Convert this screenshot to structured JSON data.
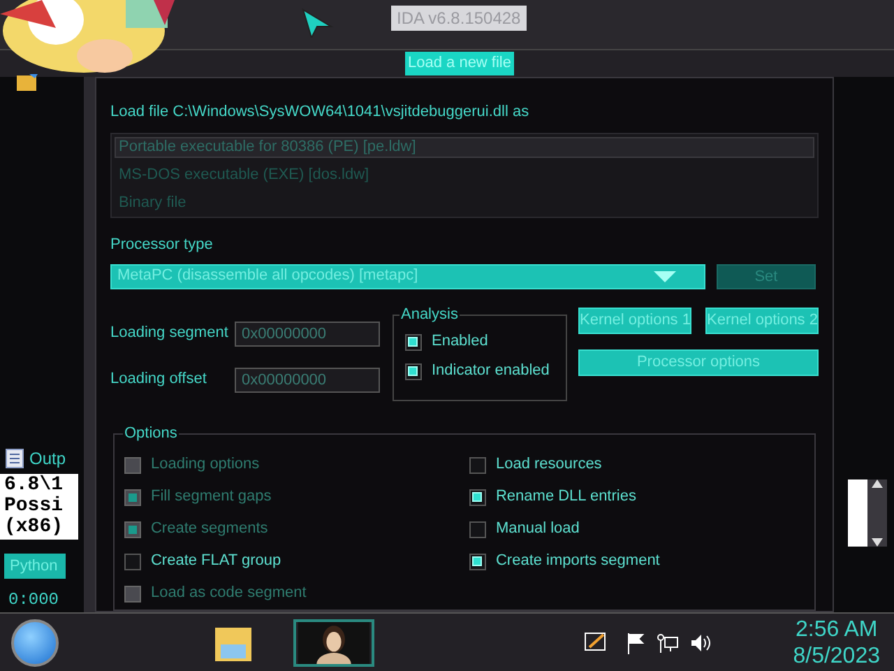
{
  "app_title": "IDA v6.8.150428",
  "left_panel": {
    "output_tab": "Outp",
    "console_lines": [
      "6.8\\1",
      "Possi",
      "(x86)"
    ],
    "python_button": "Python",
    "status": "0:000"
  },
  "dialog": {
    "title": "Load a new file",
    "file_label": "Load file C:\\Windows\\SysWOW64\\1041\\vsjitdebuggerui.dll as",
    "formats": [
      {
        "label": "Portable executable for 80386 (PE) [pe.ldw]",
        "selected": true
      },
      {
        "label": "MS-DOS executable (EXE) [dos.ldw]",
        "selected": false
      },
      {
        "label": "Binary file",
        "selected": false
      }
    ],
    "processor_label": "Processor type",
    "processor": "MetaPC (disassemble all opcodes) [metapc]",
    "set_button": {
      "label": "Set",
      "disabled": true
    },
    "loading_segment": {
      "label": "Loading segment",
      "value": "0x00000000"
    },
    "loading_offset": {
      "label": "Loading offset",
      "value": "0x00000000"
    },
    "analysis": {
      "title": "Analysis",
      "options": [
        {
          "label": "Enabled",
          "checked": true
        },
        {
          "label": "Indicator enabled",
          "checked": true
        }
      ]
    },
    "kernel_buttons": [
      "Kernel options 1",
      "Kernel options 2"
    ],
    "processor_options_button": "Processor options",
    "options": {
      "title": "Options",
      "items": [
        {
          "label": "Loading options",
          "checked": false,
          "disabled": true
        },
        {
          "label": "Load resources",
          "checked": false,
          "disabled": false
        },
        {
          "label": "Fill segment gaps",
          "checked": true,
          "disabled": true
        },
        {
          "label": "Rename DLL entries",
          "checked": true,
          "disabled": false
        },
        {
          "label": "Create segments",
          "checked": true,
          "disabled": true
        },
        {
          "label": "Manual load",
          "checked": false,
          "disabled": false
        },
        {
          "label": "Create FLAT group",
          "checked": false,
          "disabled": false
        },
        {
          "label": "Create imports segment",
          "checked": true,
          "disabled": false
        },
        {
          "label": "Load as code segment",
          "checked": false,
          "disabled": true
        }
      ]
    }
  },
  "taskbar": {
    "time": "2:56 AM",
    "date": "8/5/2023"
  }
}
